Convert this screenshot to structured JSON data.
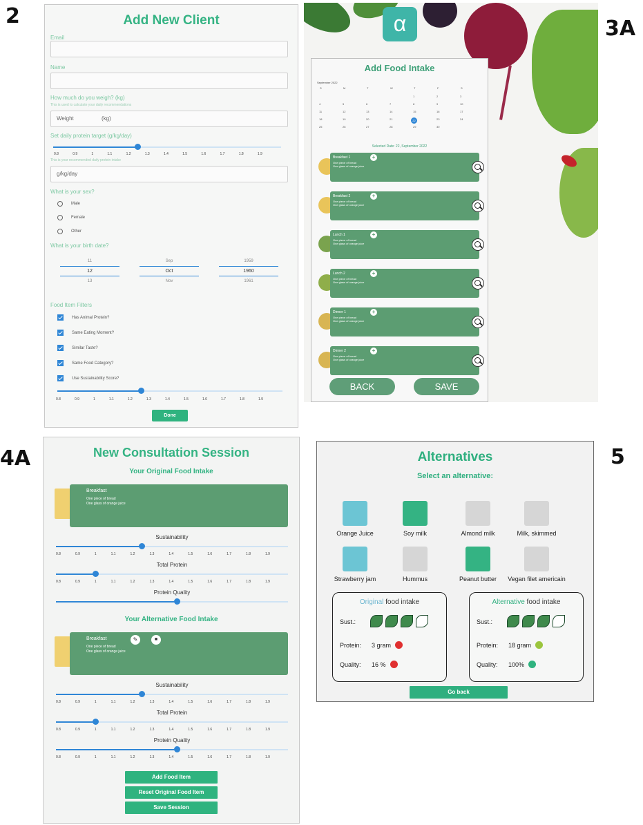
{
  "labels": {
    "p2": "2",
    "p3": "3A",
    "p4": "4A",
    "p5": "5"
  },
  "colors": {
    "accent": "#2fb37f",
    "card": "#5c9d72",
    "slider": "#2f86d6",
    "red": "#e03030",
    "lime": "#9bc53d"
  },
  "panel2": {
    "title": "Add New Client",
    "email_label": "Email",
    "name_label": "Name",
    "weight_question": "How much do you weigh? (kg)",
    "weight_hint": "This is used to calculate your daily recommendations",
    "weight_placeholder": "Weight",
    "weight_unit": "(kg)",
    "protein_question": "Set daily protein target (g/kg/day)",
    "protein_hint": "This is your recommended daily protein intake",
    "protein_placeholder": "g/kg/day",
    "protein_value": 0.37,
    "ticks": [
      "0.8",
      "0.9",
      "1",
      "1.1",
      "1.2",
      "1.3",
      "1.4",
      "1.5",
      "1.6",
      "1.7",
      "1.8",
      "1.9"
    ],
    "sex_question": "What is your sex?",
    "sex_options": [
      "Male",
      "Female",
      "Other"
    ],
    "birth_question": "What is your birth date?",
    "birth": {
      "day": {
        "prev": "11",
        "sel": "12",
        "next": "13"
      },
      "month": {
        "prev": "Sep",
        "sel": "Oct",
        "next": "Nov"
      },
      "year": {
        "prev": "1959",
        "sel": "1960",
        "next": "1961"
      }
    },
    "filters_label": "Food Item Filters",
    "filters": [
      "Has Animal Protein?",
      "Same Eating Moment?",
      "Similar Taste?",
      "Same Food Category?",
      "Use Sustainability Score?"
    ],
    "filter_value": 0.37,
    "done": "Done"
  },
  "panel3": {
    "title": "Add Food Intake",
    "month": "September 2022",
    "weekdays": [
      "S",
      "M",
      "T",
      "W",
      "T",
      "F",
      "S"
    ],
    "selected_date": "Selected Date: 22, September 2022",
    "meals": [
      {
        "name": "Breakfast 1",
        "d1": "One piece of bread",
        "d2": "One glass of orange juice"
      },
      {
        "name": "Breakfast 2",
        "d1": "One piece of bread",
        "d2": "One glass of orange juice"
      },
      {
        "name": "Lunch 1",
        "d1": "One piece of bread",
        "d2": "One glass of orange juice"
      },
      {
        "name": "Lunch 2",
        "d1": "One piece of bread",
        "d2": "One glass of orange juice"
      },
      {
        "name": "Dinner 1",
        "d1": "One piece of bread",
        "d2": "One glass of orange juice"
      },
      {
        "name": "Dinner 2",
        "d1": "One piece of bread",
        "d2": "One glass of orange juice"
      }
    ],
    "back": "BACK",
    "save": "SAVE",
    "logo": "α"
  },
  "panel4": {
    "title": "New Consultation Session",
    "orig_heading": "Your Original Food Intake",
    "alt_heading": "Your Alternative Food Intake",
    "card": {
      "name": "Breakfast",
      "d1": "One piece of bread",
      "d2": "One glass of orange juice"
    },
    "sliders": [
      {
        "label": "Sustainability",
        "value": 0.37
      },
      {
        "label": "Total Protein",
        "value": 0.17
      },
      {
        "label": "Protein Quality",
        "value": 0.52
      }
    ],
    "ticks": [
      "0.8",
      "0.9",
      "1",
      "1.1",
      "1.2",
      "1.3",
      "1.4",
      "1.5",
      "1.6",
      "1.7",
      "1.8",
      "1.9"
    ],
    "buttons": [
      "Add Food Item",
      "Reset Original Food Item",
      "Save Session"
    ]
  },
  "panel5": {
    "title": "Alternatives",
    "subtitle": "Select an alternative:",
    "items": [
      {
        "label": "Orange Juice",
        "color": "#6cc5d4"
      },
      {
        "label": "Soy milk",
        "color": "#34b383"
      },
      {
        "label": "Almond milk",
        "color": "#d6d6d6"
      },
      {
        "label": "Milk, skimmed",
        "color": "#d6d6d6"
      },
      {
        "label": "Strawberry jam",
        "color": "#6cc5d4"
      },
      {
        "label": "Hummus",
        "color": "#d6d6d6"
      },
      {
        "label": "Peanut butter",
        "color": "#34b383"
      },
      {
        "label": "Vegan filet americain",
        "color": "#d6d6d6"
      }
    ],
    "original": {
      "title_accent": "Original",
      "title_rest": " food intake",
      "sust_label": "Sust.:",
      "sust_full": 3,
      "protein_label": "Protein:",
      "protein": "3 gram",
      "protein_color": "#e03030",
      "quality_label": "Quality:",
      "quality": "16 %",
      "quality_color": "#e03030"
    },
    "alternative": {
      "title_accent": "Alternative",
      "title_rest": " food intake",
      "sust_label": "Sust.:",
      "sust_full": 3,
      "protein_label": "Protein:",
      "protein": "18 gram",
      "protein_color": "#9bc53d",
      "quality_label": "Quality:",
      "quality": "100%",
      "quality_color": "#2fb37f"
    },
    "go_back": "Go back"
  }
}
